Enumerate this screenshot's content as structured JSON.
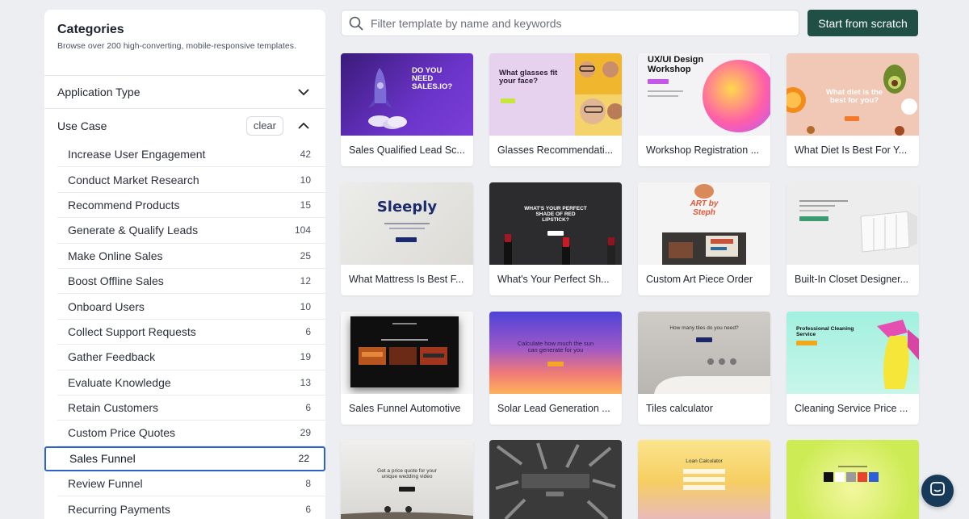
{
  "sidebar": {
    "title": "Categories",
    "subtitle": "Browse over 200 high-converting, mobile-responsive templates.",
    "application_type": {
      "label": "Application Type",
      "icon": "chevron-down-icon"
    },
    "use_case": {
      "label": "Use Case",
      "clear_label": "clear",
      "icon": "chevron-up-icon"
    },
    "items": [
      {
        "label": "Increase User Engagement",
        "count": "42"
      },
      {
        "label": "Conduct Market Research",
        "count": "10"
      },
      {
        "label": "Recommend Products",
        "count": "15"
      },
      {
        "label": "Generate & Qualify Leads",
        "count": "104"
      },
      {
        "label": "Make Online Sales",
        "count": "25"
      },
      {
        "label": "Boost Offline Sales",
        "count": "12"
      },
      {
        "label": "Onboard Users",
        "count": "10"
      },
      {
        "label": "Collect Support Requests",
        "count": "6"
      },
      {
        "label": "Gather Feedback",
        "count": "19"
      },
      {
        "label": "Evaluate Knowledge",
        "count": "13"
      },
      {
        "label": "Retain Customers",
        "count": "6"
      },
      {
        "label": "Custom Price Quotes",
        "count": "29"
      },
      {
        "label": "Sales Funnel",
        "count": "22",
        "active": true
      },
      {
        "label": "Review Funnel",
        "count": "8"
      },
      {
        "label": "Recurring Payments",
        "count": "6"
      }
    ]
  },
  "search": {
    "placeholder": "Filter template by name and keywords",
    "icon": "search-icon"
  },
  "scratch_button": {
    "label": "Start from scratch"
  },
  "templates": [
    {
      "title": "Sales Qualified Lead Sc...",
      "thumb_text": "DO YOU NEED SALES.IO?"
    },
    {
      "title": "Glasses Recommendati...",
      "thumb_text": "What glasses fit your face?"
    },
    {
      "title": "Workshop Registration ...",
      "thumb_text": "UX/UI Design Workshop"
    },
    {
      "title": "What Diet Is Best For Y...",
      "thumb_text": "What diet is the best for you?"
    },
    {
      "title": "What Mattress Is Best F...",
      "thumb_text": "Sleeply"
    },
    {
      "title": "What's Your Perfect Sh...",
      "thumb_text": "WHAT'S YOUR PERFECT SHADE OF RED LIPSTICK?"
    },
    {
      "title": "Custom Art Piece Order",
      "thumb_text": "ART by Steph"
    },
    {
      "title": "Built-In Closet Designer...",
      "thumb_text": ""
    },
    {
      "title": "Sales Funnel Automotive",
      "thumb_text": ""
    },
    {
      "title": "Solar Lead Generation ...",
      "thumb_text": "Calculate how much the sun can generate for you"
    },
    {
      "title": "Tiles calculator",
      "thumb_text": "How many tiles do you need?"
    },
    {
      "title": "Cleaning Service Price ...",
      "thumb_text": "Professional Cleaning Service"
    },
    {
      "title": "",
      "thumb_text": "Get a price quote for your unique wedding video"
    },
    {
      "title": "",
      "thumb_text": ""
    },
    {
      "title": "",
      "thumb_text": "Loan Calculator"
    },
    {
      "title": "",
      "thumb_text": ""
    }
  ],
  "chat": {
    "icon": "chat-bubble-icon"
  },
  "colors": {
    "primary": "#1f4f45",
    "active_border": "#2b63c7",
    "background": "#edeef2",
    "chat": "#173a58"
  }
}
